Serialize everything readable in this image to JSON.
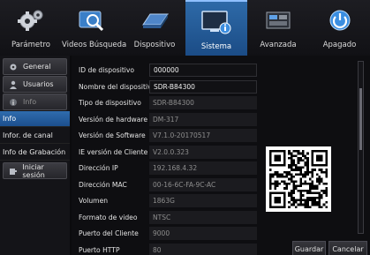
{
  "tabs": [
    {
      "label": "Parámetro",
      "icon": "gear-cog-icon"
    },
    {
      "label": "Videos Búsqueda",
      "icon": "search-magnifier-icon"
    },
    {
      "label": "Dispositivo",
      "icon": "hard-drive-icon"
    },
    {
      "label": "Sistema",
      "icon": "system-info-icon"
    },
    {
      "label": "Avanzada",
      "icon": "advanced-tools-icon"
    },
    {
      "label": "Apagado",
      "icon": "power-icon"
    }
  ],
  "active_tab": "Sistema",
  "left_menu": {
    "general": "General",
    "usuarios": "Usuarios",
    "info_sub": "Info",
    "info": "Info",
    "canal": "Infor. de canal",
    "grabacion": "Info de Grabación",
    "sesion": "Iniciar sesión"
  },
  "fields": [
    {
      "label": "ID de dispositivo",
      "value": "000000"
    },
    {
      "label": "Nombre del dispositivo",
      "value": "SDR-B84300"
    },
    {
      "label": "Tipo de dispositivo",
      "value": "SDR-B84300"
    },
    {
      "label": "Versión de hardware",
      "value": "DM-317"
    },
    {
      "label": "Versión de Software",
      "value": "V7.1.0-20170517"
    },
    {
      "label": "IE versión de Cliente",
      "value": "V2.0.0.323"
    },
    {
      "label": "Dirección IP",
      "value": "192.168.4.32"
    },
    {
      "label": "Dirección MAC",
      "value": "00-16-6C-FA-9C-AC"
    },
    {
      "label": "Volumen",
      "value": "1863G"
    },
    {
      "label": "Formato de video",
      "value": "NTSC"
    },
    {
      "label": "Puerto del Cliente",
      "value": "9000"
    },
    {
      "label": "Puerto HTTP",
      "value": "80"
    }
  ],
  "buttons": {
    "save": "Guardar",
    "cancel": "Cancelar"
  },
  "colors": {
    "active_blue": "#2e6aa8",
    "background": "#0b0b0d"
  }
}
